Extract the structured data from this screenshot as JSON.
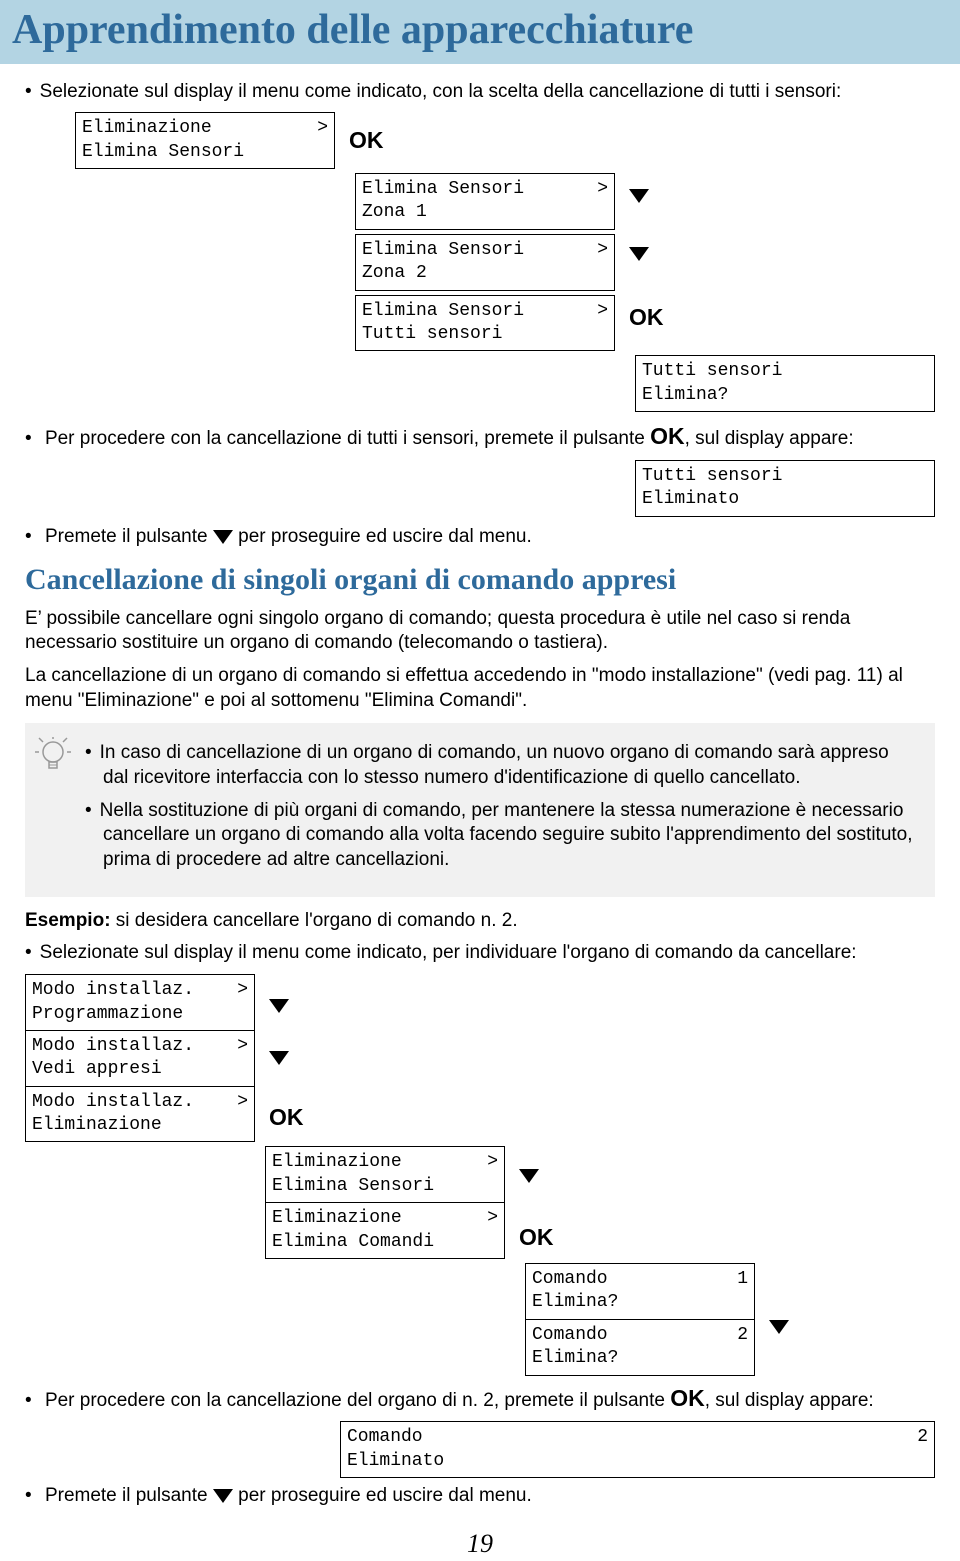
{
  "title": "Apprendimento delle apparecchiature",
  "intro_bullet": "Selezionate sul display il menu come indicato, con la scelta della cancellazione di tutti i sensori:",
  "steps1": {
    "lcd0": {
      "l1": "Eliminazione",
      "l2": "Elimina Sensori",
      "r": ">"
    },
    "lcd1": {
      "l1": "Elimina Sensori",
      "l2": "Zona 1",
      "r": ">"
    },
    "lcd2": {
      "l1": "Elimina Sensori",
      "l2": "Zona 2",
      "r": ">"
    },
    "lcd3": {
      "l1": "Elimina Sensori",
      "l2": "Tutti sensori",
      "r": ">"
    },
    "lcd4": {
      "l1": "Tutti sensori",
      "l2": "Elimina?"
    }
  },
  "ok_label": "OK",
  "bullet_proc1a": "Per procedere con la cancellazione di tutti i sensori, premete il pulsante ",
  "bullet_proc1b": ", sul display appare:",
  "result1": {
    "l1": "Tutti sensori",
    "l2": "Eliminato"
  },
  "bullet_exit_a": "Premete il pulsante ",
  "bullet_exit_b": " per proseguire ed uscire dal menu.",
  "subheading": "Cancellazione di singoli organi di comando appresi",
  "para1": "E’ possibile cancellare ogni singolo organo di comando; questa procedura è utile nel caso si renda necessario sostituire un organo di comando (telecomando o tastiera).",
  "para2": "La cancellazione di un organo di comando si effettua accedendo in \"modo installazione\" (vedi pag. 11) al menu \"Eliminazione\" e poi al sottomenu \"Elimina Comandi\".",
  "tip1": "In caso di cancellazione di un organo di comando, un nuovo organo di comando sarà appreso dal ricevitore interfaccia con lo stesso numero d'identificazione di quello cancellato.",
  "tip2": "Nella sostituzione di più organi di comando, per mantenere la stessa numerazione è necessario cancellare un organo di comando alla volta facendo seguire subito l'apprendimento del sostituto, prima di procedere ad altre cancellazioni.",
  "esempio_label": "Esempio:",
  "esempio_text": " si desidera cancellare l'organo di comando n. 2.",
  "bullet_sel2": "Selezionate sul display il menu come indicato, per individuare l'organo di comando da cancellare:",
  "cascA": {
    "a1": {
      "l1": "Modo installaz.",
      "l2": "Programmazione",
      "r": ">"
    },
    "a2": {
      "l1": "Modo installaz.",
      "l2": "Vedi appresi",
      "r": ">"
    },
    "a3": {
      "l1": "Modo installaz.",
      "l2": "Eliminazione",
      "r": ">"
    },
    "b1": {
      "l1": "Eliminazione",
      "l2": "Elimina Sensori",
      "r": ">"
    },
    "b2": {
      "l1": "Eliminazione",
      "l2": "Elimina Comandi",
      "r": ">"
    },
    "c1": {
      "l1": "Comando",
      "r1": "1",
      "l2": "Elimina?"
    },
    "c2": {
      "l1": "Comando",
      "r1": "2",
      "l2": "Elimina?"
    }
  },
  "bullet_proc2a": "Per procedere con la cancellazione del organo di n. 2, premete il pulsante ",
  "bullet_proc2b": ", sul display appare:",
  "result2": {
    "l1": "Comando",
    "r1": "2",
    "l2": "Eliminato"
  },
  "page_number": "19"
}
